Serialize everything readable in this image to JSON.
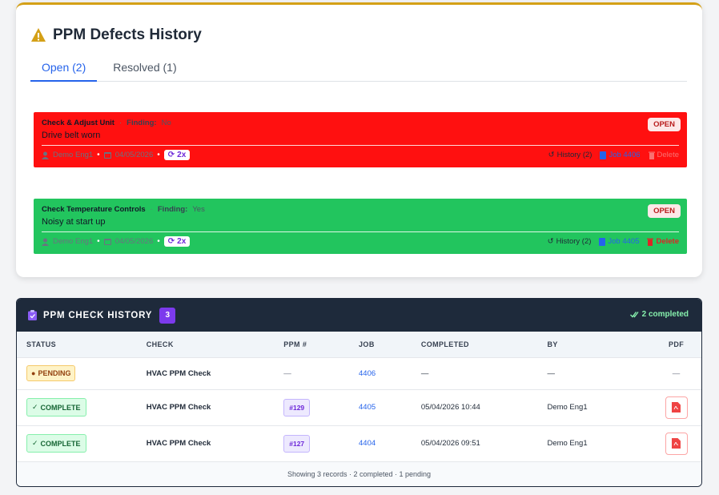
{
  "defects": {
    "title": "PPM Defects History",
    "tabs": [
      {
        "label": "Open (2)",
        "active": true
      },
      {
        "label": "Resolved (1)",
        "active": false
      }
    ],
    "items": [
      {
        "check": "Check & Adjust Unit",
        "finding_label": "Finding:",
        "finding_value": "No",
        "description": "Drive belt worn",
        "status": "OPEN",
        "engineer": "Demo Eng1",
        "date": "04/05/2026",
        "repeat": "2x",
        "history": "History (2)",
        "job": "Job 4406",
        "delete": "Delete",
        "color": "#ff1010"
      },
      {
        "check": "Check Temperature Controls",
        "finding_label": "Finding:",
        "finding_value": "Yes",
        "description": "Noisy at start up",
        "status": "OPEN",
        "engineer": "Demo Eng1",
        "date": "04/05/2026",
        "repeat": "2x",
        "history": "History (2)",
        "job": "Job 4405",
        "delete": "Delete",
        "color": "#22c55e"
      }
    ]
  },
  "history": {
    "title": "PPM CHECK HISTORY",
    "count": "3",
    "completed_summary": "2 completed",
    "columns": [
      "STATUS",
      "CHECK",
      "PPM #",
      "JOB",
      "COMPLETED",
      "BY",
      "PDF"
    ],
    "rows": [
      {
        "status": "PENDING",
        "check": "HVAC PPM Check",
        "ppm": "—",
        "job": "4406",
        "completed": "—",
        "by": "—",
        "pdf": "—"
      },
      {
        "status": "COMPLETE",
        "check": "HVAC PPM Check",
        "ppm": "#129",
        "job": "4405",
        "completed": "05/04/2026 10:44",
        "by": "Demo Eng1",
        "pdf": "pdf-icon"
      },
      {
        "status": "COMPLETE",
        "check": "HVAC PPM Check",
        "ppm": "#127",
        "job": "4404",
        "completed": "05/04/2026 09:51",
        "by": "Demo Eng1",
        "pdf": "pdf-icon"
      }
    ],
    "footer": "Showing 3 records · 2 completed · 1 pending"
  }
}
